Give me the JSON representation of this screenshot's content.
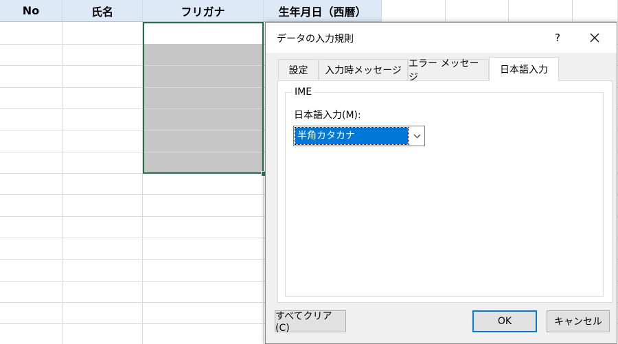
{
  "sheet": {
    "headers": [
      "No",
      "氏名",
      "フリガナ",
      "生年月日（西暦）"
    ]
  },
  "dialog": {
    "title": "データの入力規則",
    "help": "?",
    "tabs": [
      {
        "label": "設定"
      },
      {
        "label": "入力時メッセージ"
      },
      {
        "label": "エラー メッセージ"
      },
      {
        "label": "日本語入力"
      }
    ],
    "active_tab": "日本語入力",
    "ime_group": {
      "legend": "IME",
      "mode_label": "日本語入力(M):",
      "mode_value": "半角カタカナ"
    },
    "buttons": {
      "clear_all": "すべてクリア(C)",
      "ok": "OK",
      "cancel": "キャンセル"
    }
  },
  "colors": {
    "header_bg": "#dde9f6",
    "selection_border": "#217346",
    "selection_fill": "#c6c6c6",
    "highlight": "#0078d7"
  }
}
